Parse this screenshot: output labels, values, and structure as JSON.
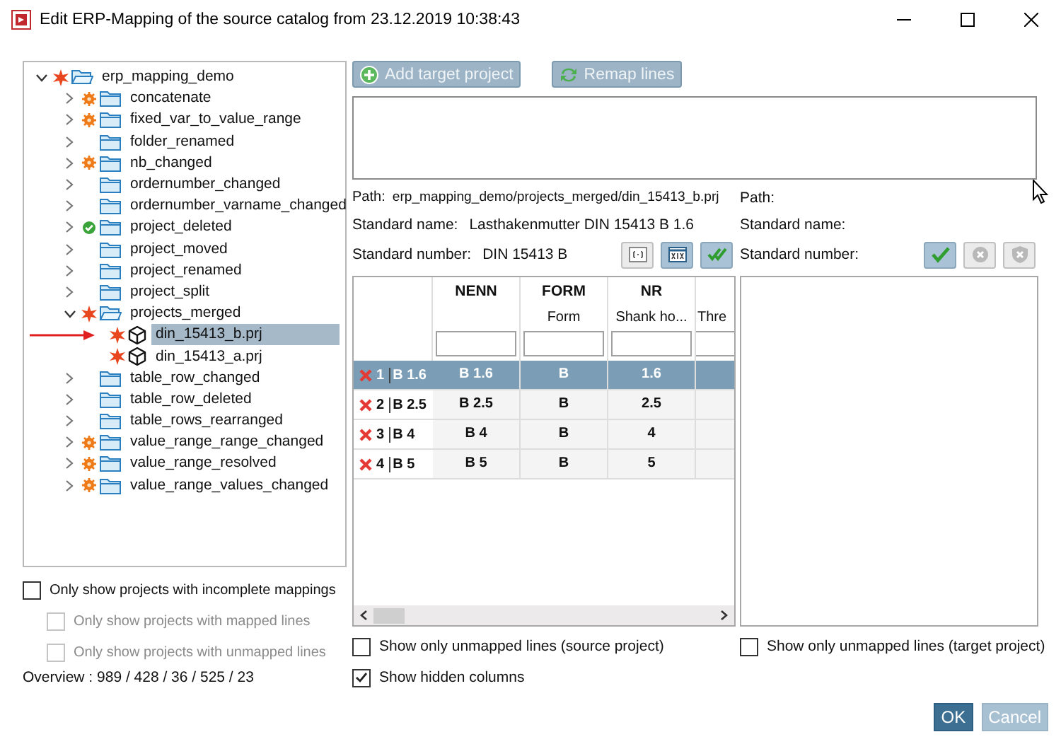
{
  "window": {
    "title": "Edit ERP-Mapping of the source catalog from 23.12.2019 10:38:43"
  },
  "tree": [
    {
      "label": "erp_mapping_demo",
      "kind": "folder",
      "conflict": true,
      "changed": false,
      "complete": false,
      "expanded": true,
      "selected": false,
      "children": [
        {
          "label": "concatenate",
          "kind": "folder",
          "conflict": false,
          "changed": true,
          "complete": false,
          "expanded": false,
          "selected": false
        },
        {
          "label": "fixed_var_to_value_range",
          "kind": "folder",
          "conflict": false,
          "changed": true,
          "complete": false,
          "expanded": false,
          "selected": false
        },
        {
          "label": "folder_renamed",
          "kind": "folder",
          "conflict": false,
          "changed": false,
          "complete": false,
          "expanded": false,
          "selected": false
        },
        {
          "label": "nb_changed",
          "kind": "folder",
          "conflict": false,
          "changed": true,
          "complete": false,
          "expanded": false,
          "selected": false
        },
        {
          "label": "ordernumber_changed",
          "kind": "folder",
          "conflict": false,
          "changed": false,
          "complete": false,
          "expanded": false,
          "selected": false
        },
        {
          "label": "ordernumber_varname_changed",
          "kind": "folder",
          "conflict": false,
          "changed": false,
          "complete": false,
          "expanded": false,
          "selected": false
        },
        {
          "label": "project_deleted",
          "kind": "folder",
          "conflict": false,
          "changed": false,
          "complete": true,
          "expanded": false,
          "selected": false
        },
        {
          "label": "project_moved",
          "kind": "folder",
          "conflict": false,
          "changed": false,
          "complete": false,
          "expanded": false,
          "selected": false
        },
        {
          "label": "project_renamed",
          "kind": "folder",
          "conflict": false,
          "changed": false,
          "complete": false,
          "expanded": false,
          "selected": false
        },
        {
          "label": "project_split",
          "kind": "folder",
          "conflict": false,
          "changed": false,
          "complete": false,
          "expanded": false,
          "selected": false
        },
        {
          "label": "projects_merged",
          "kind": "folder",
          "conflict": true,
          "changed": false,
          "complete": false,
          "expanded": true,
          "selected": false,
          "children": [
            {
              "label": "din_15413_b.prj",
              "kind": "project",
              "conflict": true,
              "changed": false,
              "complete": false,
              "selected": true,
              "pointer": true
            },
            {
              "label": "din_15413_a.prj",
              "kind": "project",
              "conflict": true,
              "changed": false,
              "complete": false,
              "selected": false
            }
          ]
        },
        {
          "label": "table_row_changed",
          "kind": "folder",
          "conflict": false,
          "changed": false,
          "complete": false,
          "expanded": false,
          "selected": false
        },
        {
          "label": "table_row_deleted",
          "kind": "folder",
          "conflict": false,
          "changed": false,
          "complete": false,
          "expanded": false,
          "selected": false
        },
        {
          "label": "table_rows_rearranged",
          "kind": "folder",
          "conflict": false,
          "changed": false,
          "complete": false,
          "expanded": false,
          "selected": false
        },
        {
          "label": "value_range_range_changed",
          "kind": "folder",
          "conflict": false,
          "changed": true,
          "complete": false,
          "expanded": false,
          "selected": false
        },
        {
          "label": "value_range_resolved",
          "kind": "folder",
          "conflict": false,
          "changed": true,
          "complete": false,
          "expanded": false,
          "selected": false
        },
        {
          "label": "value_range_values_changed",
          "kind": "folder",
          "conflict": false,
          "changed": true,
          "complete": false,
          "expanded": false,
          "selected": false
        }
      ]
    }
  ],
  "filters": [
    {
      "label": "Only show projects with incomplete mappings",
      "checked": false,
      "disabled": false,
      "nested": false
    },
    {
      "label": "Only show projects with mapped lines",
      "checked": false,
      "disabled": true,
      "nested": true
    },
    {
      "label": "Only show projects with unmapped lines",
      "checked": false,
      "disabled": true,
      "nested": true
    }
  ],
  "overview": "Overview : 989 / 428 / 36 / 525 / 23",
  "toolbar": [
    {
      "label": "Add target project",
      "disabled": true
    },
    {
      "label": "Remap lines",
      "disabled": true
    }
  ],
  "source": {
    "path_label": "Path:",
    "path": "erp_mapping_demo/projects_merged/din_15413_b.prj",
    "name_label": "Standard name:",
    "name": "Lasthakenmutter DIN 15413 B 1.6",
    "number_label": "Standard number:",
    "number": "DIN 15413 B",
    "tools": [
      {
        "on": false
      },
      {
        "on": true
      },
      {
        "on": true
      }
    ]
  },
  "target": {
    "path_label": "Path:",
    "name_label": "Standard name:",
    "number_label": "Standard number:",
    "tools": [
      {
        "on": true
      },
      {
        "on": false
      },
      {
        "on": false
      }
    ]
  },
  "table": {
    "columns": [
      {
        "name": "NENN"
      },
      {
        "name": "FORM",
        "sub": "Form"
      },
      {
        "name": "NR",
        "sub": "Shank ho..."
      },
      {
        "sub": "Thre"
      }
    ],
    "rows": [
      {
        "number": "1",
        "label": "B 1.6",
        "mapped": false,
        "selected": true,
        "cells": [
          "B 1.6",
          "B",
          "1.6"
        ]
      },
      {
        "number": "2",
        "label": "B 2.5",
        "mapped": false,
        "selected": false,
        "cells": [
          "B 2.5",
          "B",
          "2.5"
        ]
      },
      {
        "number": "3",
        "label": "B 4",
        "mapped": false,
        "selected": false,
        "cells": [
          "B 4",
          "B",
          "4"
        ]
      },
      {
        "number": "4",
        "label": "B 5",
        "mapped": false,
        "selected": false,
        "cells": [
          "B 5",
          "B",
          "5"
        ]
      }
    ]
  },
  "options": [
    {
      "label": "Show only unmapped lines (source project)",
      "checked": false
    },
    {
      "label": "Show hidden columns",
      "checked": true
    }
  ],
  "target_option": {
    "label": "Show only unmapped lines (target project)",
    "checked": false
  },
  "buttons": [
    {
      "label": "OK",
      "disabled": false
    },
    {
      "label": "Cancel",
      "disabled": true
    }
  ]
}
